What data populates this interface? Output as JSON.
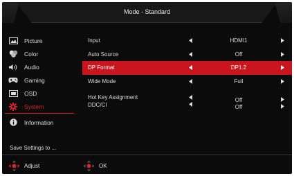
{
  "window": {
    "title": "Mode - Standard"
  },
  "sidebar": {
    "items": [
      {
        "label": "Picture",
        "icon": "picture-icon"
      },
      {
        "label": "Color",
        "icon": "color-icon"
      },
      {
        "label": "Audio",
        "icon": "audio-icon"
      },
      {
        "label": "Gaming",
        "icon": "gaming-icon"
      },
      {
        "label": "OSD",
        "icon": "osd-icon"
      },
      {
        "label": "System",
        "icon": "system-gear-icon",
        "active": true
      },
      {
        "label": "Information",
        "icon": "information-icon"
      }
    ],
    "save_label": "Save Settings to ..."
  },
  "settings": [
    {
      "label": "Input",
      "value": "HDMI1"
    },
    {
      "label": "Auto Source",
      "value": "Off"
    },
    {
      "label": "DP Format",
      "value": "DP1.2",
      "selected": true
    },
    {
      "label": "Wide Mode",
      "value": "Full"
    },
    {
      "label": "Hot Key Assignment",
      "value": "Off"
    },
    {
      "label": "DDC/CI",
      "value": "Off"
    }
  ],
  "footer": {
    "adjust_label": "Adjust",
    "ok_label": "OK"
  },
  "colors": {
    "accent": "#d9232a",
    "selected_row": "#c9161e",
    "background": "#0b0b0b"
  }
}
